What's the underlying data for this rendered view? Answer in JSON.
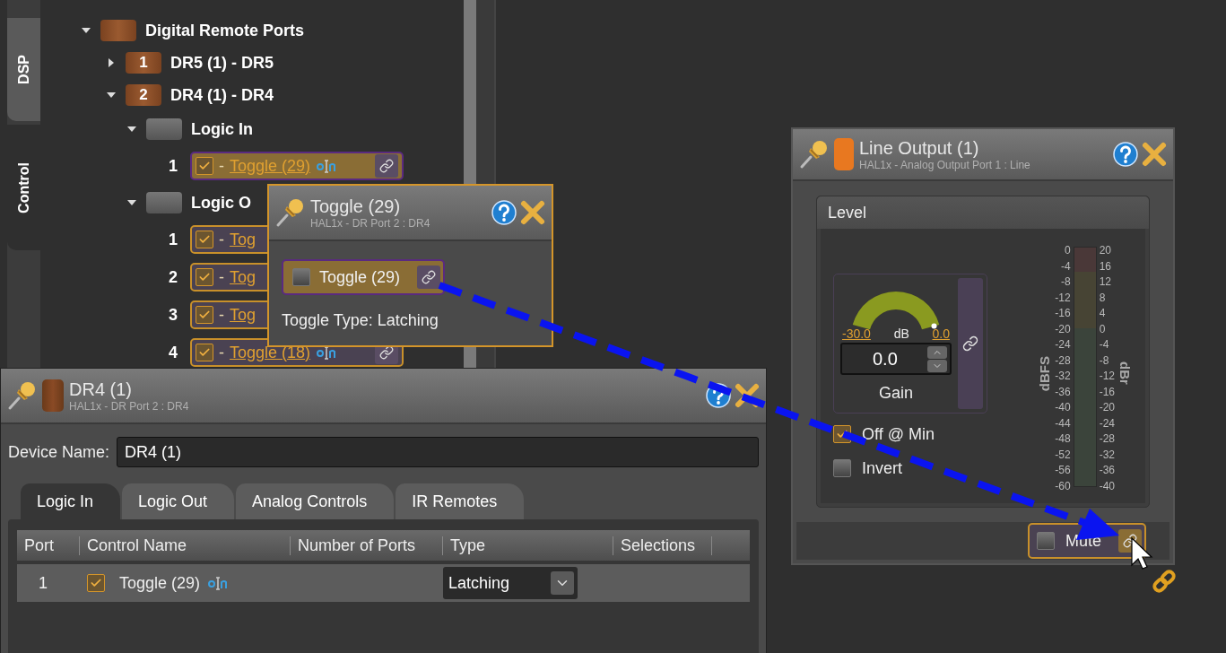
{
  "side_tabs": [
    {
      "label": "DSP",
      "selected": false
    },
    {
      "label": "Control",
      "selected": true
    }
  ],
  "tree": [
    {
      "kind": "group",
      "label": "Digital Remote Ports",
      "expanded": true,
      "children": [
        {
          "kind": "device",
          "badge": "1",
          "label": "DR5 (1) - DR5",
          "expanded": false
        },
        {
          "kind": "device",
          "badge": "2",
          "label": "DR4 (1) - DR4",
          "expanded": true,
          "children": [
            {
              "kind": "category",
              "label": "Logic In",
              "expanded": true,
              "children": [
                {
                  "kind": "control",
                  "port": "1",
                  "checked": true,
                  "dash": "-",
                  "name": "Toggle (29)",
                  "selected": true
                }
              ]
            },
            {
              "kind": "category",
              "label": "Logic O",
              "expanded": true,
              "children": [
                {
                  "kind": "covered_control",
                  "port": "1",
                  "checked": true,
                  "dash": "-",
                  "name": "Tog",
                  "selected": false
                },
                {
                  "kind": "covered_control",
                  "port": "2",
                  "checked": true,
                  "dash": "-",
                  "name": "Tog",
                  "selected": false
                },
                {
                  "kind": "covered_control",
                  "port": "3",
                  "checked": true,
                  "dash": "-",
                  "name": "Tog",
                  "selected": false
                },
                {
                  "kind": "control",
                  "port": "4",
                  "checked": true,
                  "dash": "-",
                  "name": "Toggle (18)",
                  "selected": false
                }
              ]
            }
          ]
        }
      ]
    }
  ],
  "toggle_popup": {
    "title": "Toggle (29)",
    "subtitle": "HAL1x - DR Port 2  :  DR4",
    "control": {
      "label": "Toggle (29)",
      "checked": false
    },
    "info": "Toggle Type: Latching"
  },
  "device_panel": {
    "title": "DR4 (1)",
    "subtitle": "HAL1x - DR Port 2  :  DR4",
    "device_name": {
      "label": "Device Name:",
      "value": "DR4 (1)"
    },
    "tabs": [
      {
        "label": "Logic In",
        "selected": true
      },
      {
        "label": "Logic Out",
        "selected": false
      },
      {
        "label": "Analog Controls",
        "selected": false
      },
      {
        "label": "IR Remotes",
        "selected": false
      }
    ],
    "table": {
      "columns": [
        "Port",
        "Control Name",
        "Number of Ports",
        "Type",
        "Selections"
      ],
      "rows": [
        {
          "port": "1",
          "checked": true,
          "control_name": "Toggle (29)",
          "type": "Latching",
          "selected": true
        }
      ]
    }
  },
  "line_output": {
    "title": "Line Output (1)",
    "subtitle": "HAL1x - Analog Output Port 1  :  Line",
    "group": "Level",
    "gain": {
      "min": "-30.0",
      "max": "0.0",
      "unit": "dB",
      "value": "0.0",
      "label": "Gain",
      "level": 1
    },
    "options": [
      {
        "label": "Off @ Min",
        "checked": true
      },
      {
        "label": "Invert",
        "checked": false
      }
    ],
    "meter": {
      "left_label": "dBFS",
      "right_label": "dBr",
      "left_ticks": [
        "0",
        "-4",
        "-8",
        "-12",
        "-16",
        "-20",
        "-24",
        "-28",
        "-32",
        "-36",
        "-40",
        "-44",
        "-48",
        "-52",
        "-56",
        "-60"
      ],
      "right_ticks": [
        "20",
        "16",
        "12",
        "8",
        "4",
        "0",
        "-4",
        "-8",
        "-12",
        "-16",
        "-20",
        "-24",
        "-28",
        "-32",
        "-36",
        "-40"
      ]
    },
    "mute": {
      "label": "Mute",
      "checked": false
    }
  }
}
